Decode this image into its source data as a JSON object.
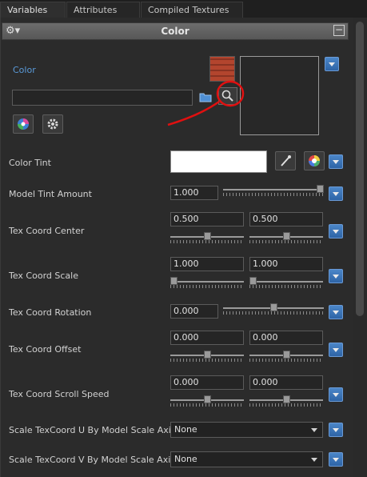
{
  "tabs": [
    {
      "label": "Variables",
      "active": true
    },
    {
      "label": "Attributes",
      "active": false
    },
    {
      "label": "Compiled Textures",
      "active": false,
      "closable": true
    }
  ],
  "section": {
    "title": "Color",
    "collapse_glyph": "−"
  },
  "color_group": {
    "label": "Color",
    "path_value": "",
    "icons": [
      "texture-thumbnail",
      "folder-icon",
      "search-magnify-icon",
      "color-picker-icon",
      "gear-icon"
    ]
  },
  "annotation": {
    "color": "#e01010",
    "shape": "red-circle-with-arrow"
  },
  "rows": {
    "color_tint": {
      "label": "Color Tint",
      "color": "#ffffff"
    },
    "model_tint": {
      "label": "Model Tint Amount",
      "value": "1.000",
      "slider": 1.0
    },
    "tex_center": {
      "label": "Tex Coord Center",
      "u": "0.500",
      "v": "0.500",
      "slider_u": 0.5,
      "slider_v": 0.5
    },
    "tex_scale": {
      "label": "Tex Coord Scale",
      "u": "1.000",
      "v": "1.000",
      "slider_u": 0.0,
      "slider_v": 0.0
    },
    "tex_rotation": {
      "label": "Tex Coord Rotation",
      "value": "0.000",
      "slider": 0.5
    },
    "tex_offset": {
      "label": "Tex Coord Offset",
      "u": "0.000",
      "v": "0.000",
      "slider_u": 0.5,
      "slider_v": 0.5
    },
    "tex_scroll": {
      "label": "Tex Coord Scroll Speed",
      "u": "0.000",
      "v": "0.000",
      "slider_u": 0.5,
      "slider_v": 0.5
    },
    "scale_u": {
      "label": "Scale TexCoord U By Model Scale Axis",
      "selected": "None"
    },
    "scale_v": {
      "label": "Scale TexCoord V By Model Scale Axis",
      "selected": "None"
    }
  },
  "colors": {
    "accent": "#3a78c2",
    "link": "#5a9ad9",
    "background": "#2b2b2b"
  }
}
